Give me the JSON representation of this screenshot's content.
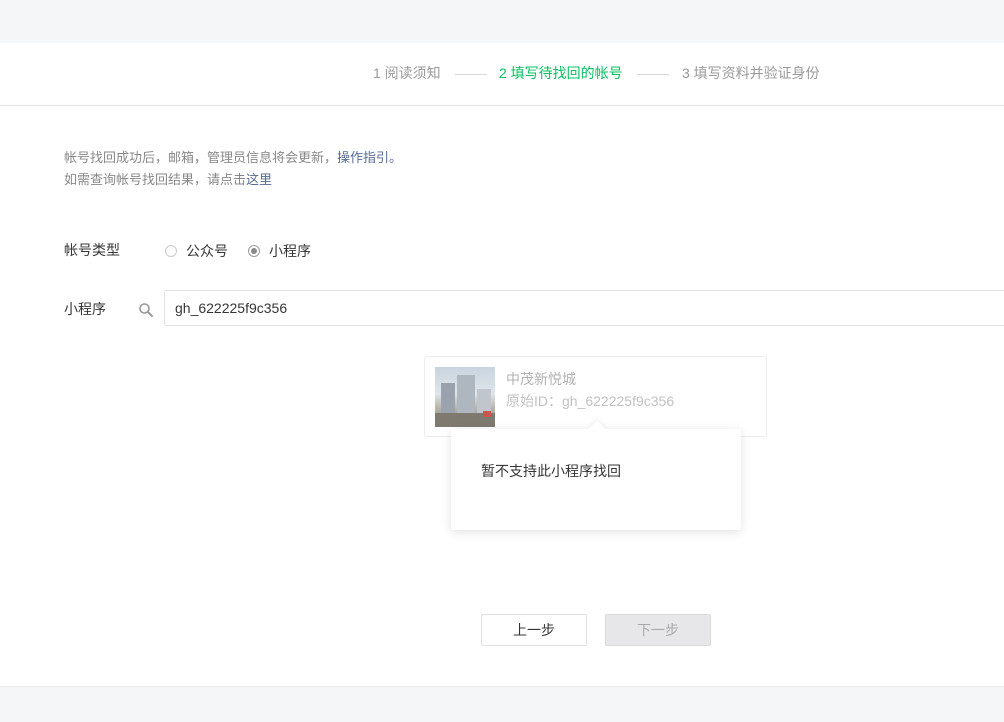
{
  "steps": [
    {
      "label": "1 阅读须知"
    },
    {
      "label": "2 填写待找回的帐号"
    },
    {
      "label": "3 填写资料并验证身份"
    }
  ],
  "tips": {
    "line1": "帐号找回成功后，邮箱，管理员信息将会更新，",
    "line1_link": "操作指引。",
    "line2": "如需查询帐号找回结果，请点击",
    "line2_link": "这里"
  },
  "account_type": {
    "label": "帐号类型",
    "options": [
      {
        "label": "公众号",
        "checked": false
      },
      {
        "label": "小程序",
        "checked": true
      }
    ]
  },
  "search": {
    "label": "小程序",
    "value": "gh_622225f9c356",
    "icon": "search-icon"
  },
  "result": {
    "name": "中茂新悦城",
    "id": "原始ID：gh_622225f9c356"
  },
  "popover": {
    "message": "暂不支持此小程序找回"
  },
  "buttons": {
    "prev": "上一步",
    "next": "下一步"
  },
  "colors": {
    "accent": "#07c160",
    "link": "#576b95"
  }
}
